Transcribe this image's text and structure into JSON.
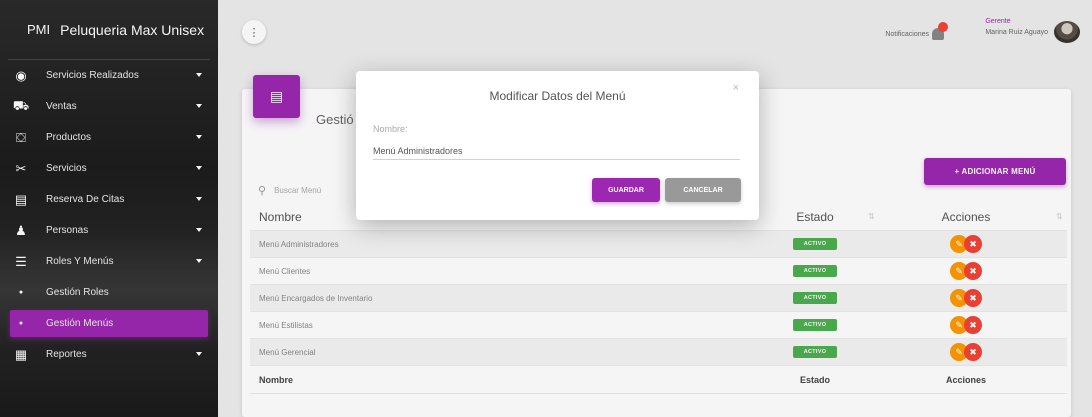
{
  "app": {
    "abbr": "PMI",
    "name": "Peluqueria Max Unisex"
  },
  "sidebar": {
    "items": [
      {
        "icon": "eye-icon",
        "glyph": "◉",
        "label": "Servicios Realizados",
        "caret": true
      },
      {
        "icon": "cart-icon",
        "glyph": "⛟",
        "label": "Ventas",
        "caret": true
      },
      {
        "icon": "basket-icon",
        "glyph": "⛋",
        "label": "Productos",
        "caret": true
      },
      {
        "icon": "scissors-icon",
        "glyph": "✂",
        "label": "Servicios",
        "caret": true
      },
      {
        "icon": "calendar-icon",
        "glyph": "▤",
        "label": "Reserva De Citas",
        "caret": true
      },
      {
        "icon": "person-icon",
        "glyph": "♟",
        "label": "Personas",
        "caret": true
      },
      {
        "icon": "list-icon",
        "glyph": "☰",
        "label": "Roles Y Menús",
        "caret": true
      },
      {
        "icon": "bullet-icon",
        "glyph": "●",
        "label": "Gestión Roles",
        "caret": false
      },
      {
        "icon": "bullet-icon",
        "glyph": "●",
        "label": "Gestión Menús",
        "caret": false
      },
      {
        "icon": "report-icon",
        "glyph": "▦",
        "label": "Reportes",
        "caret": true
      }
    ]
  },
  "topbar": {
    "menu_glyph": "⋮",
    "notifications_label": "Notificaciones",
    "user_role": "Gerente",
    "user_name": "Marina Ruiz Aguayo"
  },
  "card": {
    "icon_glyph": "▤",
    "title": "Gestió",
    "add_button": "+ ADICIONAR MENÚ",
    "search_placeholder": "Buscar Menú"
  },
  "table": {
    "headers": {
      "name": "Nombre",
      "state": "Estado",
      "actions": "Acciones"
    },
    "sort_glyph": "⇅",
    "rows": [
      {
        "name": "Menú Administradores",
        "state": "ACTIVO"
      },
      {
        "name": "Menú Clientes",
        "state": "ACTIVO"
      },
      {
        "name": "Menú Encargados de Inventario",
        "state": "ACTIVO"
      },
      {
        "name": "Menú Estilistas",
        "state": "ACTIVO"
      },
      {
        "name": "Menú Gerencial",
        "state": "ACTIVO"
      }
    ],
    "footer": {
      "name": "Nombre",
      "state": "Estado",
      "actions": "Acciones"
    }
  },
  "modal": {
    "title": "Modificar Datos del Menú",
    "close_glyph": "×",
    "field_label": "Nombre:",
    "field_value": "Menú Administradores",
    "save_label": "GUARDAR",
    "cancel_label": "CANCELAR"
  },
  "colors": {
    "accent": "#9c27b0",
    "success": "#4caf50",
    "warning": "#ff9800",
    "danger": "#f44336"
  }
}
